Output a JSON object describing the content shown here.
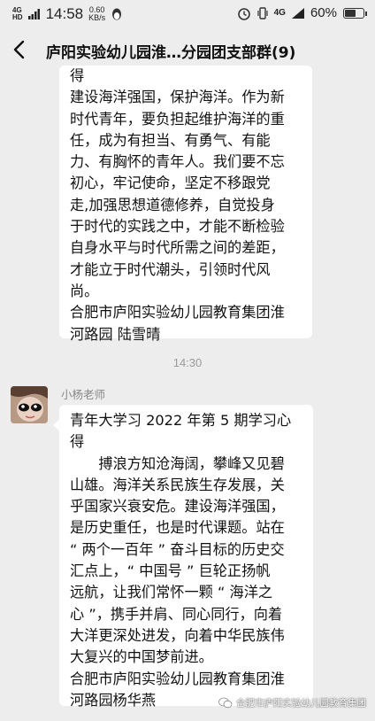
{
  "status_bar": {
    "network": "4G",
    "signal": "HD",
    "time": "14:58",
    "speed_value": "0.60",
    "speed_unit": "KB/s",
    "network_right": "4G",
    "battery": "60%",
    "battery_level": 0.6
  },
  "nav": {
    "title": "庐阳实验幼儿园淮…分园团支部群(9)"
  },
  "messages": [
    {
      "lines": [
        "得",
        "建设海洋强国，保护海洋。作为新",
        "时代青年，要负担起维护海洋的重",
        "任，成为有担当、有勇气、有能",
        "力、有胸怀的青年人。我们要不忘",
        "初心，牢记使命，坚定不移跟党",
        "走,加强思想道德修养，自觉投身",
        "于时代的实践之中，才能不断检验",
        "自身水平与时代所需之间的差距，",
        "才能立于时代潮头，引领时代风",
        "尚。",
        "合肥市庐阳实验幼儿园教育集团淮",
        "河路园 陆雪晴"
      ]
    },
    {
      "time": "14:30",
      "sender": "小杨老师",
      "lines": [
        "青年大学习 2022 年第 5 期学习心",
        "得",
        "搏浪方知沧海阔，攀峰又见碧",
        "山雄。海洋关系民族生存发展，关",
        "乎国家兴衰安危。建设海洋强国，",
        "是历史重任，也是时代课题。站在",
        "“ 两个一百年 ” 奋斗目标的历史交",
        "汇点上，“ 中国号 ” 巨轮正扬帆",
        "远航，让我们常怀一颗 “ 海洋之",
        "心 ”，携手并肩、同心同行，向着",
        "大洋更深处进发，向着中华民族伟",
        "大复兴的中国梦前进。",
        "合肥市庐阳实验幼儿园教育集团淮",
        "河路园杨华燕"
      ]
    }
  ],
  "watermark": "合肥市庐阳实验幼儿园教育集团"
}
